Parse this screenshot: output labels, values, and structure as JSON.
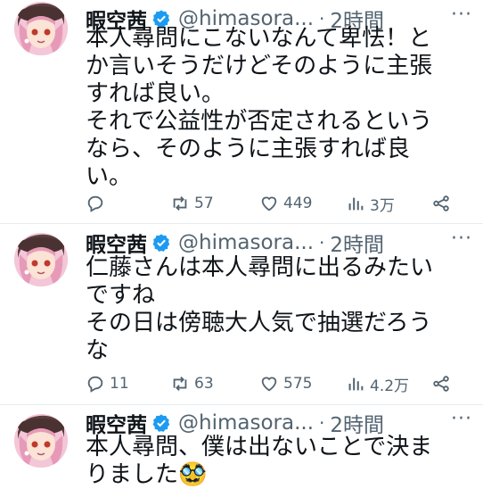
{
  "tweets": [
    {
      "name": "暇空茜",
      "handle": "@himasora...",
      "dot": "·",
      "time": "2時間",
      "more": "···",
      "lines": [
        "本人尋問にこないなんて卑怯！と",
        "か言いそうだけどそのように主張",
        "すれば良い。",
        "それで公益性が否定されるという",
        "なら、そのように主張すれば良",
        "い。"
      ],
      "replies": "",
      "retweets": "57",
      "likes": "449",
      "views": "3万"
    },
    {
      "name": "暇空茜",
      "handle": "@himasora...",
      "dot": "·",
      "time": "2時間",
      "more": "···",
      "lines": [
        "仁藤さんは本人尋問に出るみたい",
        "ですね",
        "その日は傍聴大人気で抽選だろう",
        "な"
      ],
      "replies": "11",
      "retweets": "63",
      "likes": "575",
      "views": "4.2万"
    },
    {
      "name": "暇空茜",
      "handle": "@himasora...",
      "dot": "·",
      "time": "2時間",
      "more": "···",
      "lines": [
        "本人尋問、僕は出ないことで決ま",
        "りました🥸"
      ]
    }
  ],
  "colors": {
    "text": "#0f1419",
    "secondary": "#536471",
    "verified": "#1d9bf0",
    "divider": "#e6ecf0"
  },
  "icons": [
    "verified-badge-icon",
    "reply-icon",
    "retweet-icon",
    "like-icon",
    "views-icon",
    "share-icon"
  ]
}
